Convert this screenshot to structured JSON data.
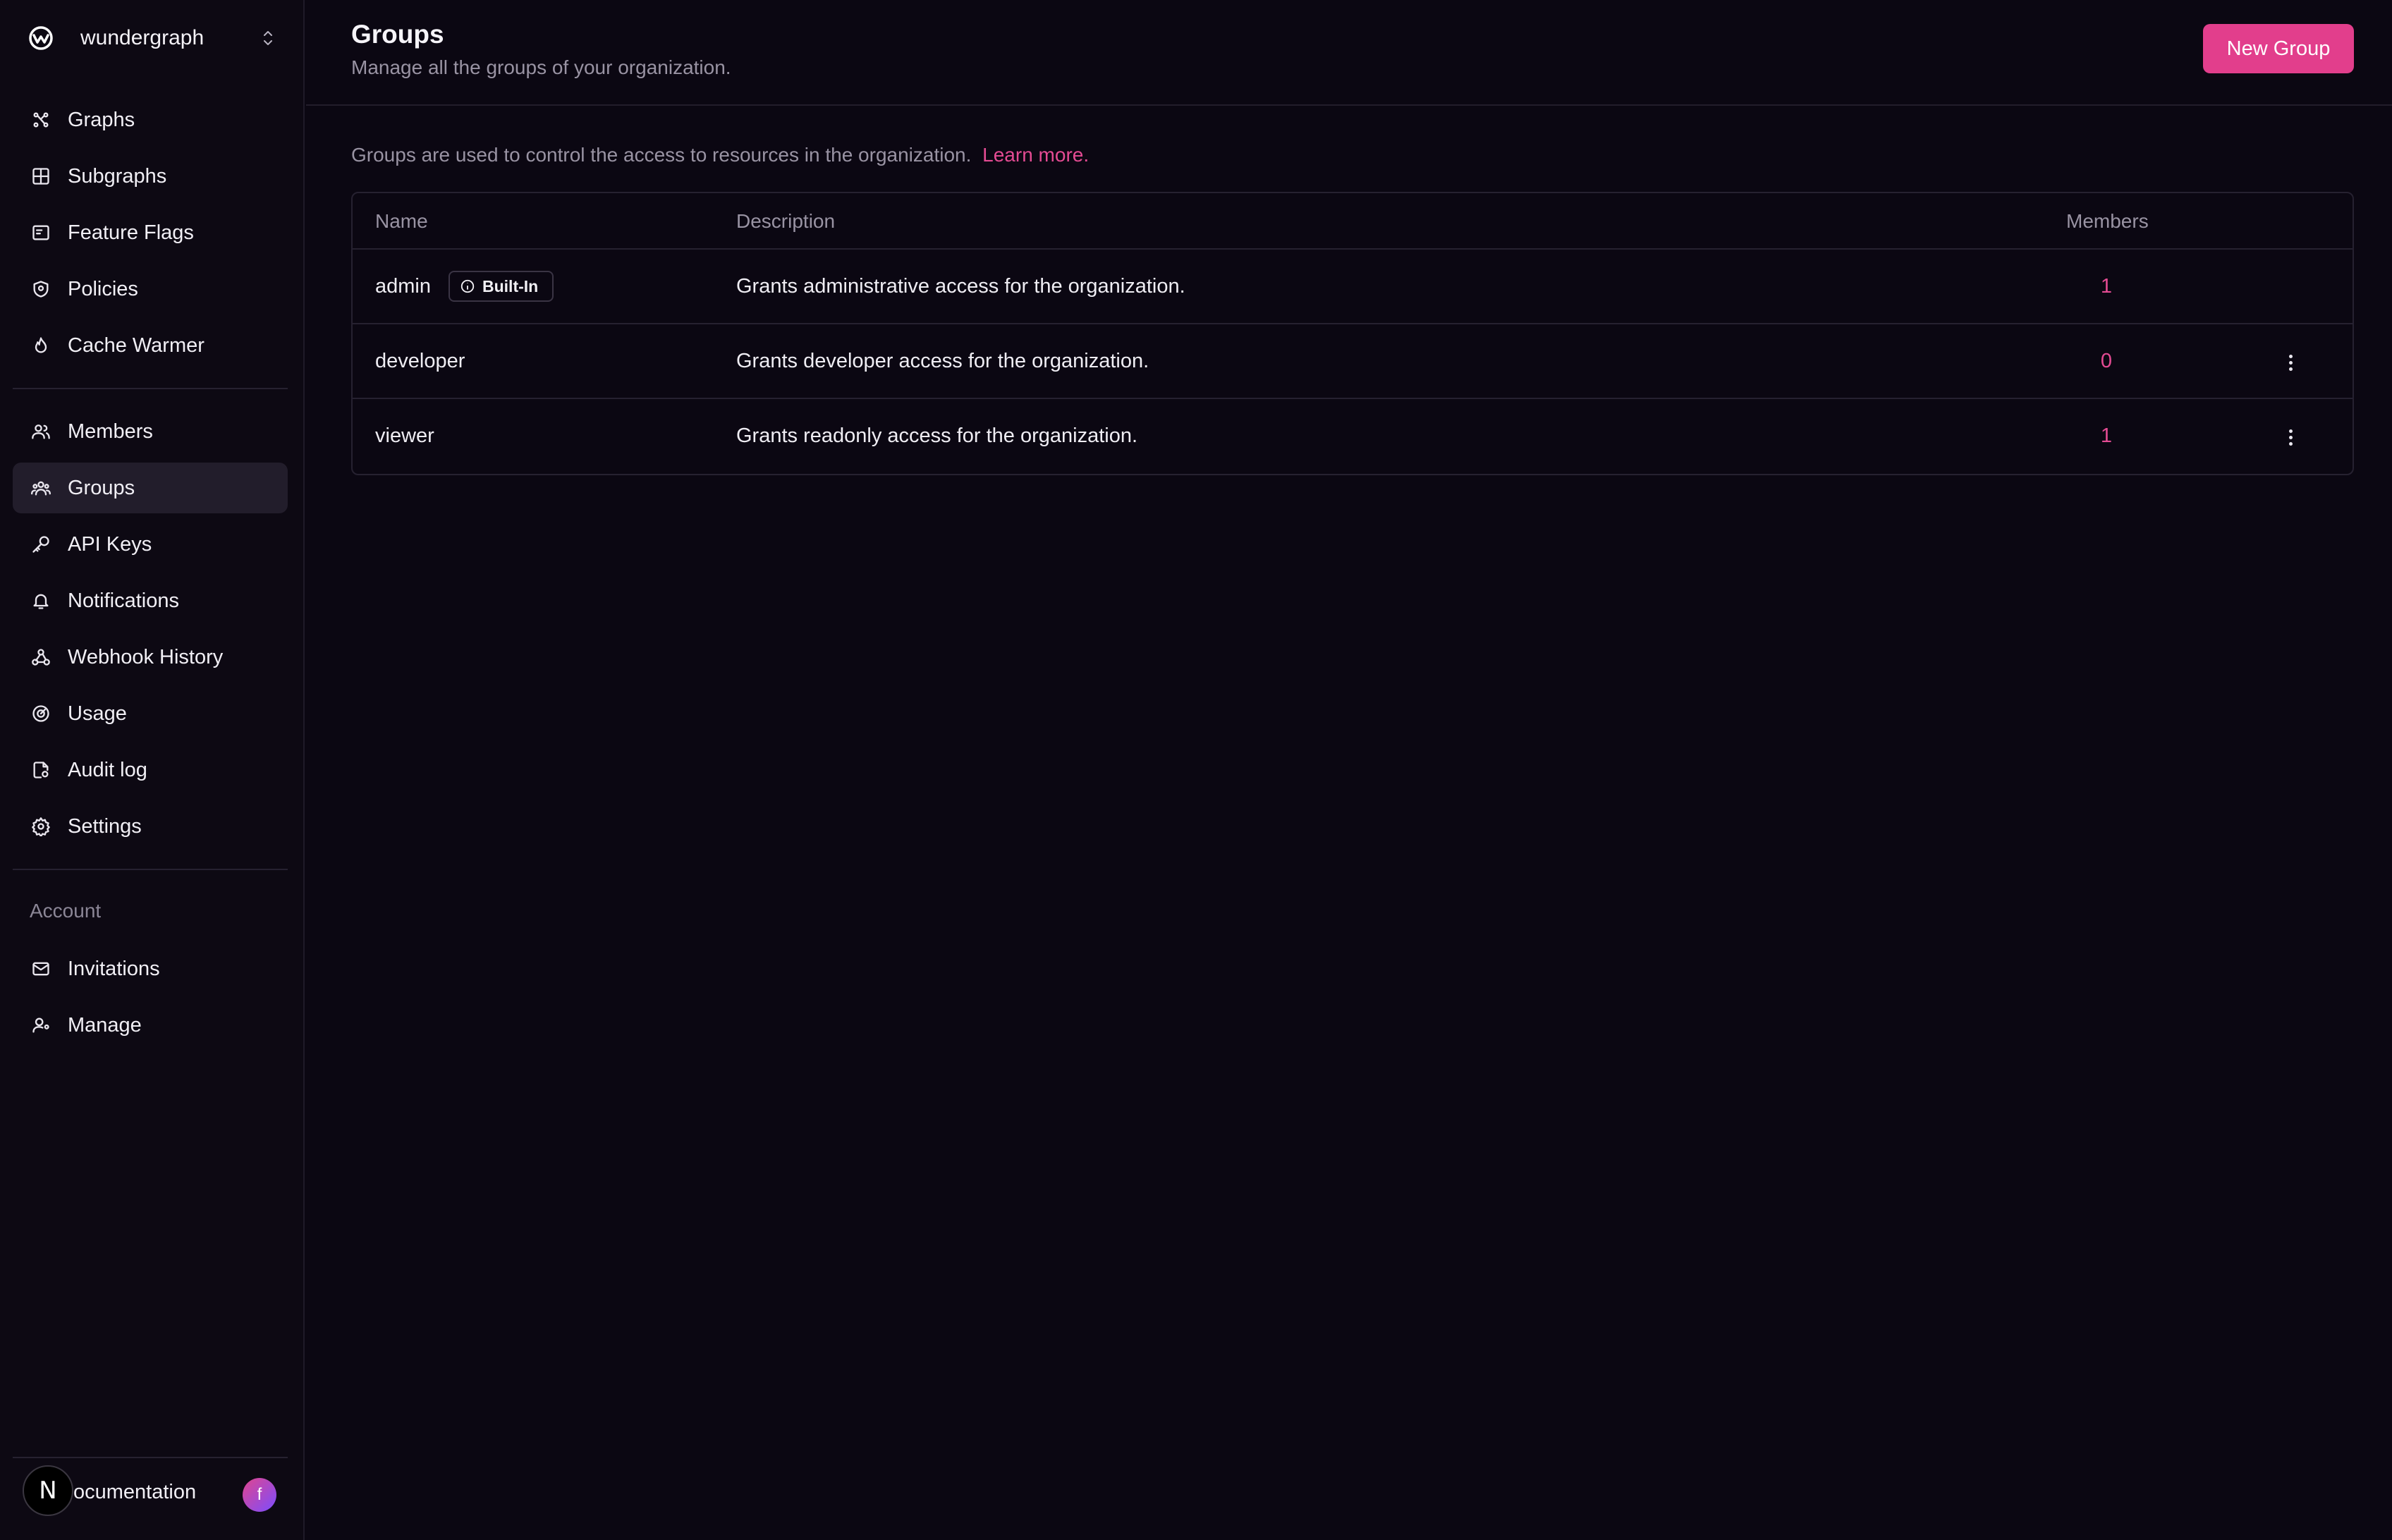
{
  "org": {
    "name": "wundergraph"
  },
  "sidebar": {
    "main_items": [
      {
        "label": "Graphs",
        "icon": "graphs-icon"
      },
      {
        "label": "Subgraphs",
        "icon": "subgraphs-icon"
      },
      {
        "label": "Feature Flags",
        "icon": "feature-flags-icon"
      },
      {
        "label": "Policies",
        "icon": "policies-icon"
      },
      {
        "label": "Cache Warmer",
        "icon": "flame-icon"
      }
    ],
    "org_items": [
      {
        "label": "Members",
        "icon": "members-icon"
      },
      {
        "label": "Groups",
        "icon": "groups-icon",
        "active": true
      },
      {
        "label": "API Keys",
        "icon": "key-icon"
      },
      {
        "label": "Notifications",
        "icon": "bell-icon"
      },
      {
        "label": "Webhook History",
        "icon": "webhook-icon"
      },
      {
        "label": "Usage",
        "icon": "usage-icon"
      },
      {
        "label": "Audit log",
        "icon": "audit-log-icon"
      },
      {
        "label": "Settings",
        "icon": "gear-icon"
      }
    ],
    "account_section": "Account",
    "account_items": [
      {
        "label": "Invitations",
        "icon": "mail-icon"
      },
      {
        "label": "Manage",
        "icon": "user-manage-icon"
      }
    ],
    "footer": {
      "badge": "N",
      "docs_label": "ocumentation",
      "avatar_initial": "f"
    }
  },
  "header": {
    "title": "Groups",
    "subtitle": "Manage all the groups of your organization.",
    "new_button": "New Group"
  },
  "info": {
    "text": "Groups are used to control the access to resources in the organization.",
    "link": "Learn more."
  },
  "table": {
    "columns": {
      "name": "Name",
      "description": "Description",
      "members": "Members"
    },
    "rows": [
      {
        "name": "admin",
        "badge": "Built-In",
        "description": "Grants administrative access for the organization.",
        "members": "1"
      },
      {
        "name": "developer",
        "description": "Grants developer access for the organization.",
        "members": "0"
      },
      {
        "name": "viewer",
        "description": "Grants readonly access for the organization.",
        "members": "1"
      }
    ]
  },
  "colors": {
    "accent": "#e23e8c",
    "background": "#0b0712",
    "sidebar": "#0d0913",
    "active_item": "#221d2b"
  }
}
